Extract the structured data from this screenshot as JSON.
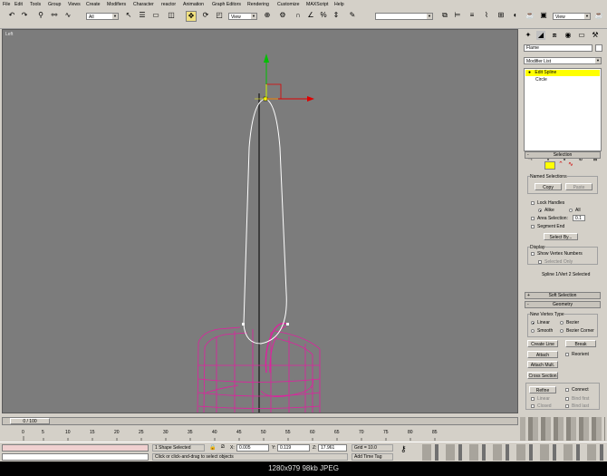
{
  "menu": [
    "File",
    "Edit",
    "Tools",
    "Group",
    "Views",
    "Create",
    "Modifiers",
    "Character",
    "reactor",
    "Animation",
    "Graph Editors",
    "Rendering",
    "Customize",
    "MAXScript",
    "Help"
  ],
  "toolbar": {
    "selection_filter": "All",
    "ref_coord": "View",
    "named_sel": "",
    "view2": "View"
  },
  "viewport": {
    "label": "Left"
  },
  "command_panel": {
    "object_name": "Flame",
    "modifier_list": "Modifier List",
    "stack": [
      {
        "label": "Edit Spline",
        "selected": true
      },
      {
        "label": "Circle",
        "selected": false
      }
    ],
    "selection_rollout": {
      "title": "Selection",
      "named_selections": "Named Selections",
      "copy": "Copy",
      "paste": "Paste",
      "lock_handles": "Lock Handles",
      "alike": "Alike",
      "all": "All",
      "area_selection": "Area Selection:",
      "area_value": "0.1",
      "segment_end": "Segment End",
      "select_by": "Select By...",
      "display": "Display",
      "show_vertex_numbers": "Show Vertex Numbers",
      "selected_only": "Selected Only",
      "status": "Spline 1/Vert 2 Selected"
    },
    "soft_selection": "Soft Selection",
    "geometry": {
      "title": "Geometry",
      "new_vertex_type": "New Vertex Type",
      "linear": "Linear",
      "bezier": "Bezier",
      "smooth": "Smooth",
      "bezier_corner": "Bezier Corner",
      "create_line": "Create Line",
      "break": "Break",
      "attach": "Attach",
      "reorient": "Reorient",
      "attach_mult": "Attach Mult.",
      "cross_section": "Cross Section",
      "refine": "Refine",
      "connect": "Connect",
      "linear2": "Linear",
      "bind_first": "Bind first",
      "closed": "Closed",
      "bind_last": "Bind last"
    }
  },
  "timeline": {
    "slider": "0 / 100",
    "ticks": [
      "0",
      "5",
      "10",
      "15",
      "20",
      "25",
      "30",
      "35",
      "40",
      "45",
      "50",
      "55",
      "60",
      "65",
      "70",
      "75",
      "80",
      "85"
    ]
  },
  "status": {
    "selected": "1 Shape Selected",
    "x": "0.005",
    "y": "0.119",
    "z": "17.961",
    "grid": "Grid = 10.0",
    "prompt": "Click or click-and-drag to select objects",
    "add_time_tag": "Add Time Tag"
  },
  "caption": "1280x979  98kb  JPEG",
  "colors": {
    "viewport_bg": "#7c7c7c",
    "spline": "#ffffff",
    "wireframe": "#e020a0",
    "selected_stack": "#ffff00"
  }
}
